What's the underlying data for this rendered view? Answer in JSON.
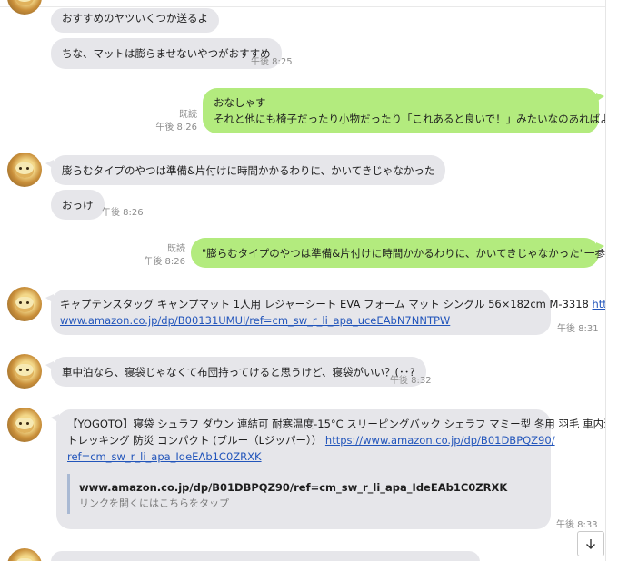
{
  "messages": {
    "m1": {
      "text": "おすすめのヤツいくつか送るよ"
    },
    "m2": {
      "text": "ちな、マットは膨らませないやつがおすすめ",
      "time": "午後 8:25"
    },
    "m3": {
      "line1": "おなしゃす",
      "line2": "それと他にも椅子だったり小物だったり「これあると良いで！」みたいなのあればよろしく頼む",
      "read": "既読",
      "time": "午後 8:26"
    },
    "m4": {
      "text": "膨らむタイプのやつは準備&片付けに時間かかるわりに、かいてきじゃなかった"
    },
    "m5": {
      "text": "おっけ",
      "time": "午後 8:26"
    },
    "m6": {
      "text": "\"膨らむタイプのやつは準備&片付けに時間かかるわりに、かいてきじゃなかった\"一参考になる",
      "read": "既読",
      "time": "午後 8:26"
    },
    "m7": {
      "text": "キャプテンスタッグ キャンプマット 1人用 レジャーシート EVA フォーム マット シングル 56×182cm M-3318 ",
      "link1": "https://",
      "link2": "www.amazon.co.jp/dp/B00131UMUI/ref=cm_sw_r_li_apa_uceEAbN7NNTPW",
      "time": "午後 8:31"
    },
    "m8": {
      "text": "車中泊なら、寝袋じゃなくて布団持ってけると思うけど、寝袋がいい？(･･?",
      "time": "午後 8:32"
    },
    "m9": {
      "line1": "【YOGOTO】寝袋 シュラフ ダウン 連結可 耐寒温度-15°C スリーピングバック シェラフ マミー型 冬用 羽毛 車内泊",
      "line2": "トレッキング 防災 コンパクト (ブルー（Lジッパー））",
      "link1": "https://www.amazon.co.jp/dp/B01DBPQZ90/",
      "link2": "ref=cm_sw_r_li_apa_IdeEAb1C0ZRXK",
      "preview_url": "www.amazon.co.jp/dp/B01DBPQZ90/ref=cm_sw_r_li_apa_IdeEAb1C0ZRXK",
      "preview_hint": "リンクを開くにはこちらをタップ",
      "time": "午後 8:33"
    }
  },
  "icons": {
    "scroll_down": "arrow-down-icon",
    "avatar": "friend-avatar"
  },
  "colors": {
    "incoming": "#e6e6ea",
    "outgoing": "#b3eb7e",
    "link": "#2255bb"
  }
}
